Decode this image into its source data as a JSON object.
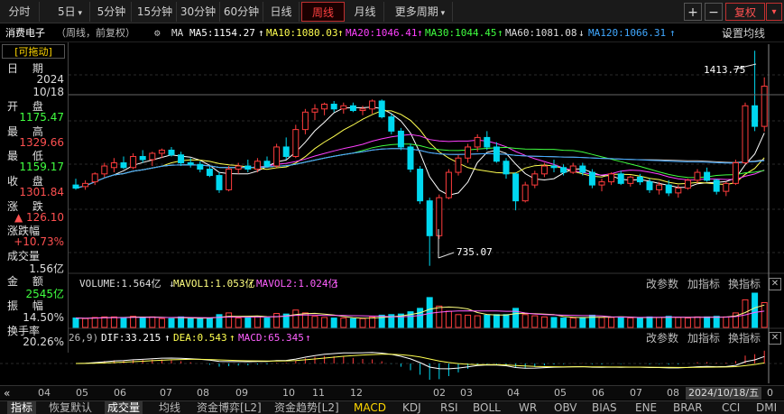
{
  "toolbar": {
    "periods": [
      "分时",
      "5日",
      "5分钟",
      "15分钟",
      "30分钟",
      "60分钟",
      "日线",
      "周线",
      "月线",
      "更多周期"
    ],
    "active_period": "周线",
    "plus": "+",
    "minus": "−",
    "adjust": "复权",
    "dropdown": "▾"
  },
  "legend": {
    "stock": "消费电子",
    "mode": "（周线，前复权）",
    "ma_label": "MA",
    "ma5": "MA5:1154.27",
    "ma10": "MA10:1080.03",
    "ma20": "MA20:1046.41",
    "ma30": "MA30:1044.45",
    "ma60": "MA60:1081.08",
    "ma120": "MA120:1066.31",
    "settings": "设置均线"
  },
  "info": {
    "drag": "[可拖动]",
    "date_label": "日 期",
    "year": "2024",
    "date": "10/18",
    "open_label": "开 盘",
    "open": "1175.47",
    "high_label": "最 高",
    "high": "1329.66",
    "low_label": "最 低",
    "low": "1159.17",
    "close_label": "收 盘",
    "close": "1301.84",
    "change_label": "涨 跌",
    "change": "▲ 126.10",
    "pct_label": "涨跌幅",
    "pct": "+10.73%",
    "vol_label": "成交量",
    "vol": "1.56亿",
    "amt_label": "金 额",
    "amt": "2545亿",
    "amp_label": "振 幅",
    "amp": "14.50%",
    "turn_label": "换手率",
    "turn": "20.26%"
  },
  "annotations": {
    "high_mark": "1413.75",
    "low_mark": "735.07"
  },
  "volume_panel": {
    "volume": "VOLUME:1.564亿",
    "mavol1": "MAVOL1:1.053亿",
    "mavol2": "MAVOL2:1.024亿",
    "params": "改参数",
    "add": "加指标",
    "swap": "换指标"
  },
  "macd_panel": {
    "prefix": "26,9)",
    "dif": "DIF:33.215",
    "dea": "DEA:0.543",
    "macd": "MACD:65.345",
    "params": "改参数",
    "add": "加指标",
    "swap": "换指标"
  },
  "xaxis": {
    "labels": [
      "04",
      "05",
      "06",
      "07",
      "08",
      "09",
      "10",
      "11",
      "12",
      "02",
      "03",
      "04",
      "05",
      "06",
      "07",
      "08",
      "0"
    ],
    "current_date": "2024/10/18/五"
  },
  "tabs": [
    "指标",
    "恢复默认",
    "成交量",
    "均线",
    "资金博弈[L2]",
    "资金趋势[L2]",
    "MACD",
    "KDJ",
    "RSI",
    "BOLL",
    "WR",
    "OBV",
    "BIAS",
    "ENE",
    "BRAR",
    "CCI",
    "DMI"
  ],
  "active_tab": "成交量",
  "colors": {
    "up": "#ff3c3c",
    "down": "#00d8f0",
    "ma5": "#ffffff",
    "ma10": "#ffff50",
    "ma20": "#ff40ff",
    "ma30": "#40ff40",
    "ma60": "#c8c8c8",
    "ma120": "#40a8ff"
  },
  "chart_data": {
    "type": "candlestick",
    "ylim": [
      700,
      1440
    ],
    "candles": [
      {
        "o": 990,
        "h": 1010,
        "l": 975,
        "c": 980
      },
      {
        "o": 985,
        "h": 1005,
        "l": 975,
        "c": 995
      },
      {
        "o": 1000,
        "h": 1030,
        "l": 990,
        "c": 1025
      },
      {
        "o": 1025,
        "h": 1060,
        "l": 1015,
        "c": 1050
      },
      {
        "o": 1045,
        "h": 1075,
        "l": 1030,
        "c": 1060
      },
      {
        "o": 1060,
        "h": 1080,
        "l": 1040,
        "c": 1045
      },
      {
        "o": 1045,
        "h": 1090,
        "l": 1040,
        "c": 1080
      },
      {
        "o": 1080,
        "h": 1100,
        "l": 1060,
        "c": 1070
      },
      {
        "o": 1070,
        "h": 1095,
        "l": 1050,
        "c": 1090
      },
      {
        "o": 1090,
        "h": 1105,
        "l": 1075,
        "c": 1100
      },
      {
        "o": 1100,
        "h": 1110,
        "l": 1080,
        "c": 1085
      },
      {
        "o": 1085,
        "h": 1095,
        "l": 1050,
        "c": 1060
      },
      {
        "o": 1060,
        "h": 1075,
        "l": 1045,
        "c": 1055
      },
      {
        "o": 1055,
        "h": 1065,
        "l": 1030,
        "c": 1040
      },
      {
        "o": 1040,
        "h": 1050,
        "l": 1015,
        "c": 1020
      },
      {
        "o": 1020,
        "h": 1030,
        "l": 965,
        "c": 975
      },
      {
        "o": 975,
        "h": 1050,
        "l": 970,
        "c": 1040
      },
      {
        "o": 1040,
        "h": 1060,
        "l": 1025,
        "c": 1050
      },
      {
        "o": 1050,
        "h": 1070,
        "l": 1030,
        "c": 1040
      },
      {
        "o": 1040,
        "h": 1075,
        "l": 1030,
        "c": 1065
      },
      {
        "o": 1065,
        "h": 1080,
        "l": 1045,
        "c": 1050
      },
      {
        "o": 1050,
        "h": 1120,
        "l": 1045,
        "c": 1110
      },
      {
        "o": 1110,
        "h": 1140,
        "l": 1070,
        "c": 1080
      },
      {
        "o": 1080,
        "h": 1180,
        "l": 1075,
        "c": 1165
      },
      {
        "o": 1165,
        "h": 1230,
        "l": 1150,
        "c": 1220
      },
      {
        "o": 1220,
        "h": 1245,
        "l": 1195,
        "c": 1230
      },
      {
        "o": 1230,
        "h": 1250,
        "l": 1210,
        "c": 1245
      },
      {
        "o": 1245,
        "h": 1255,
        "l": 1220,
        "c": 1230
      },
      {
        "o": 1230,
        "h": 1250,
        "l": 1215,
        "c": 1240
      },
      {
        "o": 1240,
        "h": 1250,
        "l": 1220,
        "c": 1225
      },
      {
        "o": 1225,
        "h": 1240,
        "l": 1210,
        "c": 1230
      },
      {
        "o": 1230,
        "h": 1260,
        "l": 1215,
        "c": 1255
      },
      {
        "o": 1255,
        "h": 1260,
        "l": 1200,
        "c": 1205
      },
      {
        "o": 1205,
        "h": 1215,
        "l": 1150,
        "c": 1160
      },
      {
        "o": 1160,
        "h": 1170,
        "l": 1100,
        "c": 1110
      },
      {
        "o": 1110,
        "h": 1120,
        "l": 1030,
        "c": 1040
      },
      {
        "o": 1040,
        "h": 1050,
        "l": 930,
        "c": 940
      },
      {
        "o": 940,
        "h": 950,
        "l": 735,
        "c": 830
      },
      {
        "o": 830,
        "h": 960,
        "l": 820,
        "c": 950
      },
      {
        "o": 950,
        "h": 1040,
        "l": 945,
        "c": 1030
      },
      {
        "o": 1030,
        "h": 1085,
        "l": 1020,
        "c": 1075
      },
      {
        "o": 1075,
        "h": 1120,
        "l": 1060,
        "c": 1110
      },
      {
        "o": 1110,
        "h": 1150,
        "l": 1095,
        "c": 1140
      },
      {
        "o": 1140,
        "h": 1160,
        "l": 1100,
        "c": 1110
      },
      {
        "o": 1110,
        "h": 1125,
        "l": 1060,
        "c": 1065
      },
      {
        "o": 1065,
        "h": 1075,
        "l": 1010,
        "c": 1025
      },
      {
        "o": 1025,
        "h": 1030,
        "l": 910,
        "c": 940
      },
      {
        "o": 940,
        "h": 1000,
        "l": 935,
        "c": 990
      },
      {
        "o": 990,
        "h": 1035,
        "l": 980,
        "c": 1025
      },
      {
        "o": 1025,
        "h": 1060,
        "l": 1015,
        "c": 1050
      },
      {
        "o": 1050,
        "h": 1070,
        "l": 1030,
        "c": 1045
      },
      {
        "o": 1045,
        "h": 1055,
        "l": 1020,
        "c": 1030
      },
      {
        "o": 1030,
        "h": 1060,
        "l": 1025,
        "c": 1050
      },
      {
        "o": 1050,
        "h": 1060,
        "l": 1020,
        "c": 1030
      },
      {
        "o": 1030,
        "h": 1040,
        "l": 980,
        "c": 990
      },
      {
        "o": 990,
        "h": 1010,
        "l": 970,
        "c": 1000
      },
      {
        "o": 1000,
        "h": 1030,
        "l": 990,
        "c": 1025
      },
      {
        "o": 1025,
        "h": 1035,
        "l": 990,
        "c": 995
      },
      {
        "o": 995,
        "h": 1020,
        "l": 985,
        "c": 1015
      },
      {
        "o": 1015,
        "h": 1025,
        "l": 990,
        "c": 1000
      },
      {
        "o": 1000,
        "h": 1010,
        "l": 965,
        "c": 975
      },
      {
        "o": 975,
        "h": 1000,
        "l": 960,
        "c": 990
      },
      {
        "o": 990,
        "h": 1005,
        "l": 955,
        "c": 965
      },
      {
        "o": 965,
        "h": 990,
        "l": 950,
        "c": 980
      },
      {
        "o": 980,
        "h": 1010,
        "l": 975,
        "c": 1005
      },
      {
        "o": 1005,
        "h": 1040,
        "l": 995,
        "c": 1030
      },
      {
        "o": 1030,
        "h": 1045,
        "l": 1000,
        "c": 1005
      },
      {
        "o": 1005,
        "h": 1010,
        "l": 960,
        "c": 970
      },
      {
        "o": 970,
        "h": 1000,
        "l": 955,
        "c": 995
      },
      {
        "o": 995,
        "h": 1070,
        "l": 990,
        "c": 1060
      },
      {
        "o": 1060,
        "h": 1250,
        "l": 1055,
        "c": 1240
      },
      {
        "o": 1240,
        "h": 1413.75,
        "l": 1160,
        "c": 1175
      },
      {
        "o": 1175,
        "h": 1329.66,
        "l": 1159,
        "c": 1301.84
      }
    ]
  }
}
